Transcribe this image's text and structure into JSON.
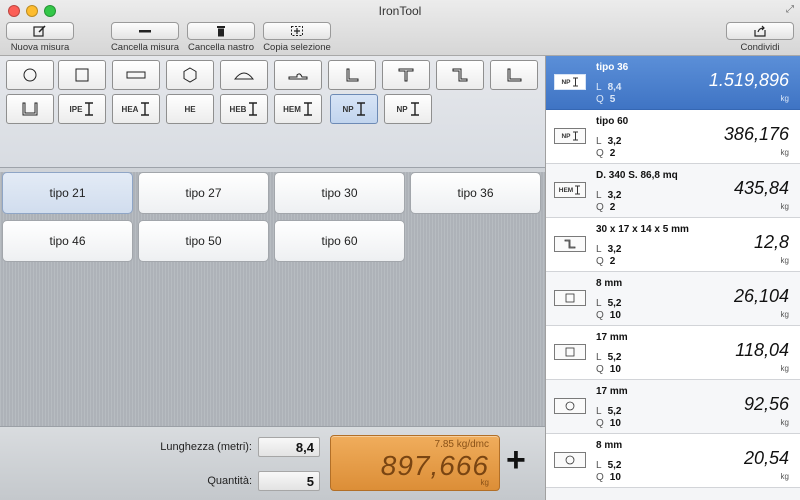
{
  "window": {
    "title": "IronTool"
  },
  "toolbar": {
    "new_measure": "Nuova misura",
    "delete_measure": "Cancella misura",
    "delete_tape": "Cancella nastro",
    "copy_selection": "Copia selezione",
    "share": "Condividi"
  },
  "shapes": {
    "row1": [
      "circle",
      "square",
      "flat-bar",
      "hexagon",
      "half-round",
      "bulb-flat",
      "angle",
      "tee",
      "z-section",
      "unequal-angle"
    ],
    "row2": [
      "U",
      "IPE",
      "HEA",
      "HE",
      "HEB",
      "HEM",
      "NP",
      "NP"
    ],
    "selected": "NP"
  },
  "types": [
    "tipo 21",
    "tipo 27",
    "tipo 30",
    "tipo 36",
    "tipo 46",
    "tipo 50",
    "tipo 60"
  ],
  "selected_type": "tipo 21",
  "inputs": {
    "length_label": "Lunghezza (metri):",
    "length_value": "8,4",
    "quantity_label": "Quantità:",
    "quantity_value": "5"
  },
  "display": {
    "density": "7.85 kg/dmc",
    "weight": "897,666",
    "unit": "kg"
  },
  "list": [
    {
      "icon": "NP",
      "name": "tipo 36",
      "L": "8,4",
      "Q": "5",
      "weight": "1.519,896",
      "unit": "kg",
      "selected": true
    },
    {
      "icon": "NP",
      "name": "tipo 60",
      "L": "3,2",
      "Q": "2",
      "weight": "386,176",
      "unit": "kg"
    },
    {
      "icon": "HEM",
      "name": "D. 340 S. 86,8 mq",
      "L": "3,2",
      "Q": "2",
      "weight": "435,84",
      "unit": "kg"
    },
    {
      "icon": "z-section",
      "name": "30 x 17 x 14 x 5 mm",
      "L": "3,2",
      "Q": "2",
      "weight": "12,8",
      "unit": "kg"
    },
    {
      "icon": "square",
      "name": "8 mm",
      "L": "5,2",
      "Q": "10",
      "weight": "26,104",
      "unit": "kg"
    },
    {
      "icon": "square",
      "name": "17 mm",
      "L": "5,2",
      "Q": "10",
      "weight": "118,04",
      "unit": "kg"
    },
    {
      "icon": "circle",
      "name": "17 mm",
      "L": "5,2",
      "Q": "10",
      "weight": "92,56",
      "unit": "kg"
    },
    {
      "icon": "circle",
      "name": "8 mm",
      "L": "5,2",
      "Q": "10",
      "weight": "20,54",
      "unit": "kg"
    }
  ],
  "labels": {
    "L": "L",
    "Q": "Q"
  },
  "colors": {
    "selection": "#3f74c4",
    "lcd": "#e89a45"
  }
}
